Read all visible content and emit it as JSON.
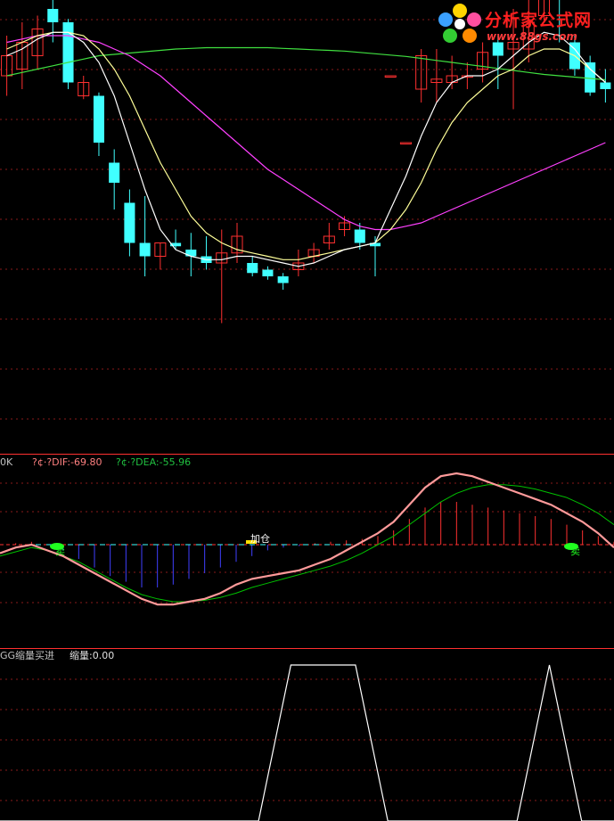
{
  "logo": {
    "name": "分析家公式网",
    "url": "www.88gs.com"
  },
  "macd_panel": {
    "label_prefix": "0K",
    "dif_label": "?¢·?DIF:-69.80",
    "dea_label": "?¢·?DEA:-55.96",
    "annotations": [
      "卖",
      "加仓",
      "卖"
    ],
    "colors": {
      "dif": "#ff9a9a",
      "dea": "#00c000",
      "hist_pos": "#ff3030",
      "hist_neg": "#4040ff",
      "zero": "#ff3030"
    }
  },
  "volume_panel": {
    "title": "GG缩量买进",
    "value_label": "缩量:0.00"
  },
  "chart_data": [
    {
      "type": "candlestick",
      "panel": "price",
      "grid": "dashed-horizontal",
      "colors": {
        "up": "#ff3030",
        "down": "#40ffff",
        "ma_short": "#ffffff",
        "ma_mid": "#ffff99",
        "ma_long": "#ff40ff",
        "ma_longest": "#40e040"
      },
      "candles": [
        {
          "o": 6,
          "c": 9,
          "h": 12,
          "l": 3
        },
        {
          "o": 7,
          "c": 11,
          "h": 14,
          "l": 4
        },
        {
          "o": 9,
          "c": 13,
          "h": 15,
          "l": 7
        },
        {
          "o": 16,
          "c": 14,
          "h": 18,
          "l": 11
        },
        {
          "o": 14,
          "c": 5,
          "h": 14.5,
          "l": 4
        },
        {
          "o": 3,
          "c": 5,
          "h": 6,
          "l": 2.5
        },
        {
          "o": 3,
          "c": -4,
          "h": 3.5,
          "l": -6
        },
        {
          "o": -7,
          "c": -10,
          "h": -5,
          "l": -14
        },
        {
          "o": -13,
          "c": -19,
          "h": -11,
          "l": -21
        },
        {
          "o": -19,
          "c": -21,
          "h": -12,
          "l": -24
        },
        {
          "o": -21,
          "c": -19,
          "h": -19,
          "l": -23
        },
        {
          "o": -19,
          "c": -19.5,
          "h": -17,
          "l": -20
        },
        {
          "o": -20,
          "c": -21,
          "h": -17.5,
          "l": -24
        },
        {
          "o": -21,
          "c": -22,
          "h": -18,
          "l": -23
        },
        {
          "o": -22,
          "c": -20.5,
          "h": -17,
          "l": -31
        },
        {
          "o": -20.5,
          "c": -18,
          "h": -16,
          "l": -22
        },
        {
          "o": -22,
          "c": -23.5,
          "h": -21,
          "l": -24
        },
        {
          "o": -23,
          "c": -24,
          "h": -22.5,
          "l": -24.5
        },
        {
          "o": -24,
          "c": -25,
          "h": -23.5,
          "l": -26
        },
        {
          "o": -23,
          "c": -22,
          "h": -20,
          "l": -24
        },
        {
          "o": -21,
          "c": -20,
          "h": -19,
          "l": -22
        },
        {
          "o": -19,
          "c": -18,
          "h": -16,
          "l": -20
        },
        {
          "o": -17,
          "c": -16,
          "h": -15,
          "l": -18
        },
        {
          "o": -17,
          "c": -19,
          "h": -16,
          "l": -20
        },
        {
          "o": -19,
          "c": -19.5,
          "h": -18,
          "l": -24
        },
        {
          "o": 6,
          "c": 6,
          "h": 6,
          "l": 6
        },
        {
          "o": -4,
          "c": -4,
          "h": -4,
          "l": -4
        },
        {
          "o": 4,
          "c": 9,
          "h": 10,
          "l": 2
        },
        {
          "o": 5,
          "c": 5.5,
          "h": 10,
          "l": 2
        },
        {
          "o": 5,
          "c": 6,
          "h": 9,
          "l": 4
        },
        {
          "o": 6,
          "c": 6,
          "h": 8,
          "l": 4
        },
        {
          "o": 7,
          "c": 9.5,
          "h": 11,
          "l": 5
        },
        {
          "o": 11,
          "c": 9,
          "h": 12,
          "l": 4
        },
        {
          "o": 10,
          "c": 11,
          "h": 16,
          "l": 1
        },
        {
          "o": 10,
          "c": 14,
          "h": 19,
          "l": 8
        },
        {
          "o": 15,
          "c": 21,
          "h": 26,
          "l": 14
        },
        {
          "o": 21,
          "c": 18,
          "h": 23,
          "l": 11
        },
        {
          "o": 11,
          "c": 7,
          "h": 12,
          "l": 6
        },
        {
          "o": 8,
          "c": 3.5,
          "h": 9,
          "l": 3
        },
        {
          "o": 5,
          "c": 4,
          "h": 7,
          "l": 2
        }
      ],
      "ma_short": [
        9,
        10,
        11.5,
        12.5,
        12.5,
        11,
        8,
        3,
        -4,
        -11,
        -17,
        -20,
        -21,
        -21.5,
        -21.5,
        -21,
        -21,
        -21.5,
        -22,
        -22.5,
        -22,
        -21,
        -20,
        -19.5,
        -19,
        -14,
        -9,
        -3,
        2,
        5,
        6,
        6,
        7,
        9,
        11,
        12.5,
        12,
        10,
        7,
        5
      ],
      "ma_mid": [
        10,
        11,
        12,
        12.5,
        12.5,
        12,
        10,
        7,
        3,
        -2,
        -7,
        -11,
        -15,
        -17.5,
        -19,
        -20,
        -20.5,
        -21,
        -21.5,
        -21.5,
        -21,
        -20.5,
        -20,
        -19.5,
        -19,
        -17,
        -14,
        -10,
        -5,
        -1,
        2,
        4,
        6,
        7,
        9,
        10,
        10,
        9,
        7,
        5
      ],
      "ma_long": [
        11,
        11.5,
        12,
        12,
        12,
        11.5,
        11,
        10,
        9,
        7.5,
        6,
        4,
        2,
        0,
        -2,
        -4,
        -6,
        -8,
        -9.5,
        -11,
        -12.5,
        -14,
        -15.5,
        -16.5,
        -17,
        -17,
        -16.5,
        -16,
        -15,
        -14,
        -13,
        -12,
        -11,
        -10,
        -9,
        -8,
        -7,
        -6,
        -5,
        -4
      ],
      "ma_longest": [
        6,
        6.5,
        7,
        7.5,
        8,
        8.5,
        9,
        9.2,
        9.4,
        9.6,
        9.8,
        10,
        10.1,
        10.2,
        10.2,
        10.2,
        10.2,
        10.2,
        10.1,
        10,
        9.9,
        9.8,
        9.7,
        9.5,
        9.3,
        9.1,
        8.9,
        8.6,
        8.3,
        8,
        7.7,
        7.4,
        7.1,
        6.8,
        6.5,
        6.2,
        6,
        5.8,
        5.6,
        5.4
      ]
    },
    {
      "type": "line",
      "panel": "macd",
      "grid": "dashed-horizontal",
      "dif": [
        -6,
        -2,
        0,
        -4,
        -8,
        -14,
        -20,
        -26,
        -32,
        -38,
        -42,
        -42,
        -40,
        -38,
        -34,
        -28,
        -24,
        -22,
        -20,
        -18,
        -14,
        -10,
        -4,
        2,
        8,
        16,
        28,
        40,
        48,
        50,
        48,
        44,
        40,
        36,
        32,
        28,
        22,
        16,
        8,
        -2
      ],
      "dea": [
        -8,
        -5,
        -2,
        -4,
        -8,
        -12,
        -18,
        -24,
        -30,
        -35,
        -38,
        -40,
        -40,
        -39,
        -37,
        -34,
        -30,
        -27,
        -24,
        -21,
        -18,
        -15,
        -11,
        -6,
        0,
        6,
        14,
        22,
        30,
        36,
        40,
        42,
        42,
        41,
        39,
        36,
        33,
        28,
        22,
        14
      ],
      "histogram": [
        0,
        1,
        2,
        0,
        -4,
        -10,
        -16,
        -22,
        -26,
        -30,
        -30,
        -28,
        -24,
        -20,
        -16,
        -12,
        -8,
        -4,
        -2,
        -1,
        1,
        2,
        3,
        4,
        6,
        10,
        18,
        26,
        30,
        30,
        28,
        26,
        24,
        22,
        20,
        18,
        14,
        10,
        6,
        2
      ]
    },
    {
      "type": "line",
      "panel": "volume",
      "grid": "dashed-horizontal",
      "values": [
        0,
        0,
        0,
        0,
        0,
        0,
        0,
        0,
        0,
        1,
        1,
        1,
        0,
        0,
        0,
        0,
        0,
        1,
        0,
        0
      ]
    }
  ]
}
